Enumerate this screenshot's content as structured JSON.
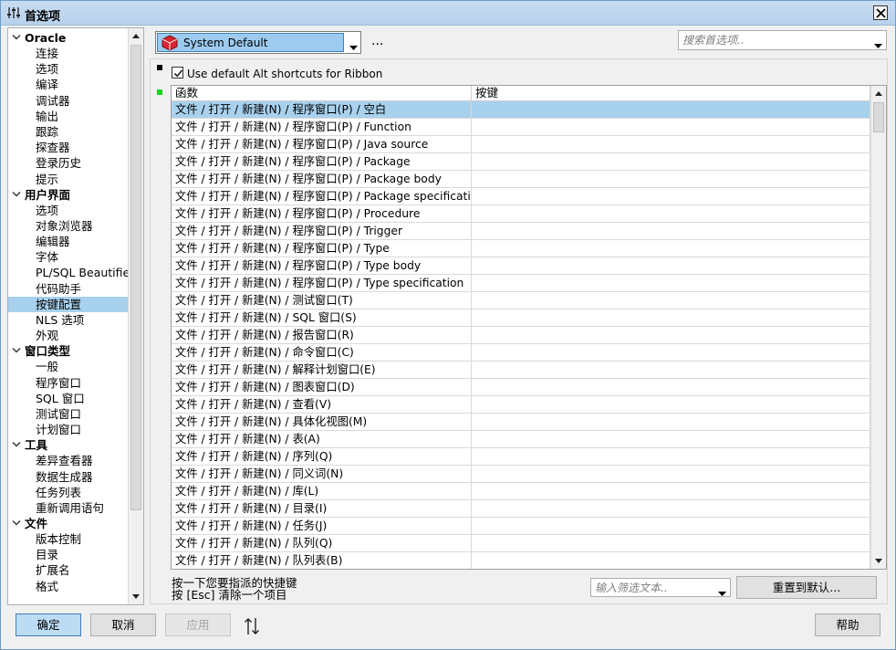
{
  "window": {
    "title": "首选项"
  },
  "tree": {
    "groups": [
      {
        "label": "Oracle",
        "items": [
          "连接",
          "选项",
          "编译",
          "调试器",
          "输出",
          "跟踪",
          "探查器",
          "登录历史",
          "提示"
        ]
      },
      {
        "label": "用户界面",
        "items": [
          "选项",
          "对象浏览器",
          "编辑器",
          "字体",
          "PL/SQL Beautifier",
          "代码助手",
          "按键配置",
          "NLS 选项",
          "外观"
        ]
      },
      {
        "label": "窗口类型",
        "items": [
          "一般",
          "程序窗口",
          "SQL 窗口",
          "测试窗口",
          "计划窗口"
        ]
      },
      {
        "label": "工具",
        "items": [
          "差异查看器",
          "数据生成器",
          "任务列表",
          "重新调用语句"
        ]
      },
      {
        "label": "文件",
        "items": [
          "版本控制",
          "目录",
          "扩展名",
          "格式"
        ]
      }
    ],
    "selected": "按键配置"
  },
  "theme": {
    "value": "System Default"
  },
  "more_label": "...",
  "search": {
    "placeholder": "搜索首选项.."
  },
  "ribbon_checkbox": {
    "label": "Use default Alt shortcuts for Ribbon",
    "checked": true
  },
  "grid": {
    "columns": [
      "函数",
      "按键"
    ],
    "rows": [
      [
        "文件 / 打开 / 新建(N) / 程序窗口(P) / 空白",
        ""
      ],
      [
        "文件 / 打开 / 新建(N) / 程序窗口(P) / Function",
        ""
      ],
      [
        "文件 / 打开 / 新建(N) / 程序窗口(P) / Java source",
        ""
      ],
      [
        "文件 / 打开 / 新建(N) / 程序窗口(P) / Package",
        ""
      ],
      [
        "文件 / 打开 / 新建(N) / 程序窗口(P) / Package body",
        ""
      ],
      [
        "文件 / 打开 / 新建(N) / 程序窗口(P) / Package specification",
        ""
      ],
      [
        "文件 / 打开 / 新建(N) / 程序窗口(P) / Procedure",
        ""
      ],
      [
        "文件 / 打开 / 新建(N) / 程序窗口(P) / Trigger",
        ""
      ],
      [
        "文件 / 打开 / 新建(N) / 程序窗口(P) / Type",
        ""
      ],
      [
        "文件 / 打开 / 新建(N) / 程序窗口(P) / Type body",
        ""
      ],
      [
        "文件 / 打开 / 新建(N) / 程序窗口(P) / Type specification",
        ""
      ],
      [
        "文件 / 打开 / 新建(N) / 测试窗口(T)",
        ""
      ],
      [
        "文件 / 打开 / 新建(N) / SQL 窗口(S)",
        ""
      ],
      [
        "文件 / 打开 / 新建(N) / 报告窗口(R)",
        ""
      ],
      [
        "文件 / 打开 / 新建(N) / 命令窗口(C)",
        ""
      ],
      [
        "文件 / 打开 / 新建(N) / 解释计划窗口(E)",
        ""
      ],
      [
        "文件 / 打开 / 新建(N) / 图表窗口(D)",
        ""
      ],
      [
        "文件 / 打开 / 新建(N) / 查看(V)",
        ""
      ],
      [
        "文件 / 打开 / 新建(N) / 具体化视图(M)",
        ""
      ],
      [
        "文件 / 打开 / 新建(N) / 表(A)",
        ""
      ],
      [
        "文件 / 打开 / 新建(N) / 序列(Q)",
        ""
      ],
      [
        "文件 / 打开 / 新建(N) / 同义词(N)",
        ""
      ],
      [
        "文件 / 打开 / 新建(N) / 库(L)",
        ""
      ],
      [
        "文件 / 打开 / 新建(N) / 目录(I)",
        ""
      ],
      [
        "文件 / 打开 / 新建(N) / 任务(J)",
        ""
      ],
      [
        "文件 / 打开 / 新建(N) / 队列(Q)",
        ""
      ],
      [
        "文件 / 打开 / 新建(N) / 队列表(B)",
        ""
      ]
    ],
    "selected_row": 0
  },
  "hints": {
    "line1": "按一下您要指派的快捷键",
    "line2": "按 [Esc] 清除一个项目"
  },
  "filter": {
    "placeholder": "输入筛选文本.."
  },
  "buttons": {
    "reset": "重置到默认...",
    "ok": "确定",
    "cancel": "取消",
    "apply": "应用",
    "help": "帮助"
  },
  "colors": {
    "selection": "#a8d1ee",
    "title_bar": "#bcd5ee",
    "marker_green": "#1bcf22"
  },
  "icons": {
    "title": "sliders-icon",
    "close": "close-icon",
    "theme": "cube-icon",
    "sort": "sort-icon"
  }
}
